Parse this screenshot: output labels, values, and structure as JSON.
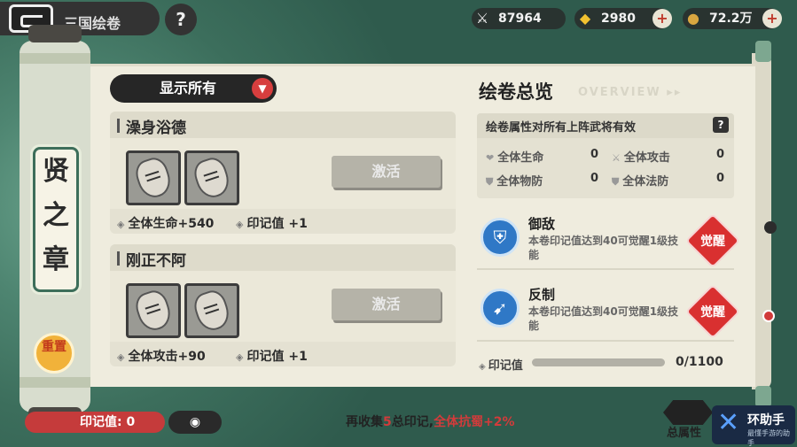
{
  "topbar": {
    "title": "三国绘卷",
    "help": "?"
  },
  "resources": [
    {
      "icon": "crossed-swords-icon",
      "glyph": "⚔",
      "value": "87964",
      "plus": false
    },
    {
      "icon": "gold-ingot-icon",
      "glyph": "◆",
      "value": "2980",
      "plus": true
    },
    {
      "icon": "coin-icon",
      "glyph": "●",
      "value": "72.2万",
      "plus": true
    }
  ],
  "sidebar": {
    "chapter": [
      "贤",
      "之",
      "章"
    ],
    "reset_label": "重置"
  },
  "filter": {
    "label": "显示所有",
    "dropdown": "▼"
  },
  "cards": [
    {
      "name": "澡身浴德",
      "activate": "激活",
      "stat1": "全体生命+540",
      "stat2": "印记值 +1"
    },
    {
      "name": "刚正不阿",
      "activate": "激活",
      "stat1": "全体攻击+90",
      "stat2": "印记值 +1"
    }
  ],
  "overview": {
    "title": "绘卷总览",
    "title_en": "OVERVIEW ▸▸",
    "note": "绘卷属性对所有上阵武将有效",
    "help": "?",
    "attrs": [
      {
        "label": "全体生命",
        "value": "0"
      },
      {
        "label": "全体攻击",
        "value": "0"
      },
      {
        "label": "全体物防",
        "value": "0"
      },
      {
        "label": "全体法防",
        "value": "0"
      }
    ],
    "skills": [
      {
        "name": "御敌",
        "desc": "本卷印记值达到40可觉醒1级技能",
        "awaken": "觉醒"
      },
      {
        "name": "反制",
        "desc": "本卷印记值达到40可觉醒1级技能",
        "awaken": "觉醒"
      }
    ],
    "progress": {
      "label": "印记值",
      "value": "0/1100",
      "fraction": 0
    }
  },
  "bottom": {
    "mark": "印记值: 0",
    "hint_prefix": "再收集",
    "hint_num": "5",
    "hint_mid": "总印记,",
    "hint_bonus": "全体抗蜀+2%",
    "total": "总属性"
  },
  "watermark": {
    "name": "环助手",
    "sub": "最懂手游的助手"
  }
}
